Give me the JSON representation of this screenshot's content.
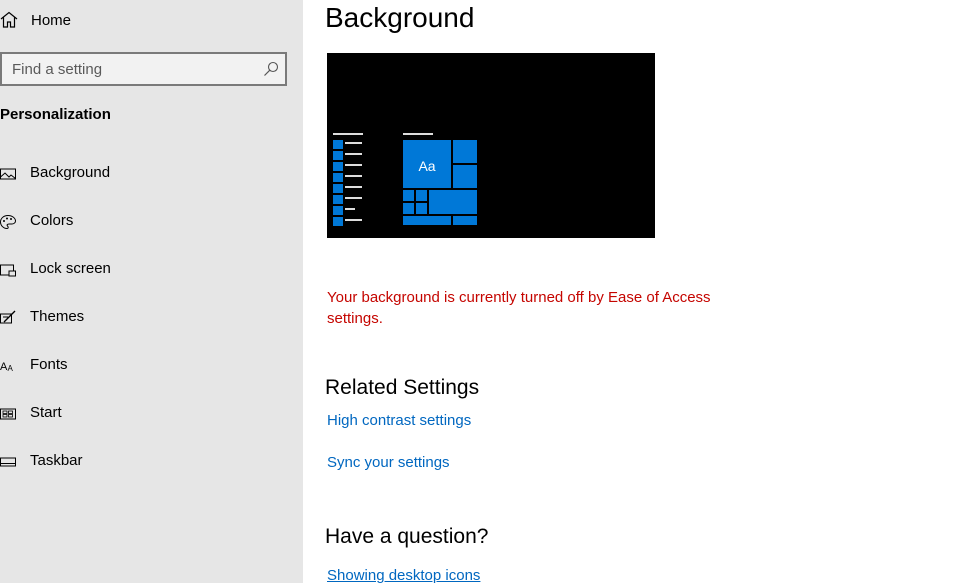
{
  "sidebar": {
    "home_label": "Home",
    "search_placeholder": "Find a setting",
    "section_title": "Personalization",
    "items": [
      {
        "label": "Background",
        "icon": "picture-icon"
      },
      {
        "label": "Colors",
        "icon": "palette-icon"
      },
      {
        "label": "Lock screen",
        "icon": "lock-screen-icon"
      },
      {
        "label": "Themes",
        "icon": "themes-icon"
      },
      {
        "label": "Fonts",
        "icon": "fonts-icon"
      },
      {
        "label": "Start",
        "icon": "start-icon"
      },
      {
        "label": "Taskbar",
        "icon": "taskbar-icon"
      }
    ]
  },
  "main": {
    "title": "Background",
    "preview": {
      "tile_text": "Aa",
      "accent": "#0078d7",
      "bg": "#000000"
    },
    "warning": "Your background is currently turned off by Ease of Access settings.",
    "related_title": "Related Settings",
    "related_links": [
      "High contrast settings",
      "Sync your settings"
    ],
    "question_title": "Have a question?",
    "question_links": [
      "Showing desktop icons"
    ]
  },
  "colors": {
    "sidebar_bg": "#e6e6e6",
    "link": "#0067c0",
    "warning": "#c50500",
    "accent": "#0078d7"
  }
}
